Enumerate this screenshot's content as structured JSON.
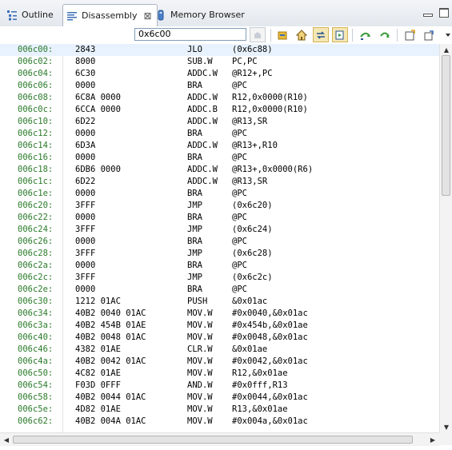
{
  "tabs": [
    {
      "label": "Outline",
      "icon": "outline-icon"
    },
    {
      "label": "Disassembly",
      "icon": "disassembly-icon",
      "close": "⊠"
    },
    {
      "label": "Memory Browser",
      "icon": "memory-browser-icon"
    }
  ],
  "toolbar": {
    "address": "0x6c00"
  },
  "colors": {
    "address_text": "#2a7a2a",
    "current_row": "#e8f2fe"
  },
  "rows": [
    {
      "addr": "006c00:",
      "op": "2843",
      "mn": "JLO",
      "arg": "(0x6c88)"
    },
    {
      "addr": "006c02:",
      "op": "8000",
      "mn": "SUB.W",
      "arg": "PC,PC"
    },
    {
      "addr": "006c04:",
      "op": "6C30",
      "mn": "ADDC.W",
      "arg": "@R12+,PC"
    },
    {
      "addr": "006c06:",
      "op": "0000",
      "mn": "BRA",
      "arg": "@PC"
    },
    {
      "addr": "006c08:",
      "op": "6C8A 0000",
      "mn": "ADDC.W",
      "arg": "R12,0x0000(R10)"
    },
    {
      "addr": "006c0c:",
      "op": "6CCA 0000",
      "mn": "ADDC.B",
      "arg": "R12,0x0000(R10)"
    },
    {
      "addr": "006c10:",
      "op": "6D22",
      "mn": "ADDC.W",
      "arg": "@R13,SR"
    },
    {
      "addr": "006c12:",
      "op": "0000",
      "mn": "BRA",
      "arg": "@PC"
    },
    {
      "addr": "006c14:",
      "op": "6D3A",
      "mn": "ADDC.W",
      "arg": "@R13+,R10"
    },
    {
      "addr": "006c16:",
      "op": "0000",
      "mn": "BRA",
      "arg": "@PC"
    },
    {
      "addr": "006c18:",
      "op": "6DB6 0000",
      "mn": "ADDC.W",
      "arg": "@R13+,0x0000(R6)"
    },
    {
      "addr": "006c1c:",
      "op": "6D22",
      "mn": "ADDC.W",
      "arg": "@R13,SR"
    },
    {
      "addr": "006c1e:",
      "op": "0000",
      "mn": "BRA",
      "arg": "@PC"
    },
    {
      "addr": "006c20:",
      "op": "3FFF",
      "mn": "JMP",
      "arg": "(0x6c20)"
    },
    {
      "addr": "006c22:",
      "op": "0000",
      "mn": "BRA",
      "arg": "@PC"
    },
    {
      "addr": "006c24:",
      "op": "3FFF",
      "mn": "JMP",
      "arg": "(0x6c24)"
    },
    {
      "addr": "006c26:",
      "op": "0000",
      "mn": "BRA",
      "arg": "@PC"
    },
    {
      "addr": "006c28:",
      "op": "3FFF",
      "mn": "JMP",
      "arg": "(0x6c28)"
    },
    {
      "addr": "006c2a:",
      "op": "0000",
      "mn": "BRA",
      "arg": "@PC"
    },
    {
      "addr": "006c2c:",
      "op": "3FFF",
      "mn": "JMP",
      "arg": "(0x6c2c)"
    },
    {
      "addr": "006c2e:",
      "op": "0000",
      "mn": "BRA",
      "arg": "@PC"
    },
    {
      "addr": "006c30:",
      "op": "1212 01AC",
      "mn": "PUSH",
      "arg": "&0x01ac"
    },
    {
      "addr": "006c34:",
      "op": "40B2 0040 01AC",
      "mn": "MOV.W",
      "arg": "#0x0040,&0x01ac"
    },
    {
      "addr": "006c3a:",
      "op": "40B2 454B 01AE",
      "mn": "MOV.W",
      "arg": "#0x454b,&0x01ae"
    },
    {
      "addr": "006c40:",
      "op": "40B2 0048 01AC",
      "mn": "MOV.W",
      "arg": "#0x0048,&0x01ac"
    },
    {
      "addr": "006c46:",
      "op": "4382 01AE",
      "mn": "CLR.W",
      "arg": "&0x01ae"
    },
    {
      "addr": "006c4a:",
      "op": "40B2 0042 01AC",
      "mn": "MOV.W",
      "arg": "#0x0042,&0x01ac"
    },
    {
      "addr": "006c50:",
      "op": "4C82 01AE",
      "mn": "MOV.W",
      "arg": "R12,&0x01ae"
    },
    {
      "addr": "006c54:",
      "op": "F03D 0FFF",
      "mn": "AND.W",
      "arg": "#0x0fff,R13"
    },
    {
      "addr": "006c58:",
      "op": "40B2 0044 01AC",
      "mn": "MOV.W",
      "arg": "#0x0044,&0x01ac"
    },
    {
      "addr": "006c5e:",
      "op": "4D82 01AE",
      "mn": "MOV.W",
      "arg": "R13,&0x01ae"
    },
    {
      "addr": "006c62:",
      "op": "40B2 004A 01AC",
      "mn": "MOV.W",
      "arg": "#0x004a,&0x01ac"
    }
  ]
}
